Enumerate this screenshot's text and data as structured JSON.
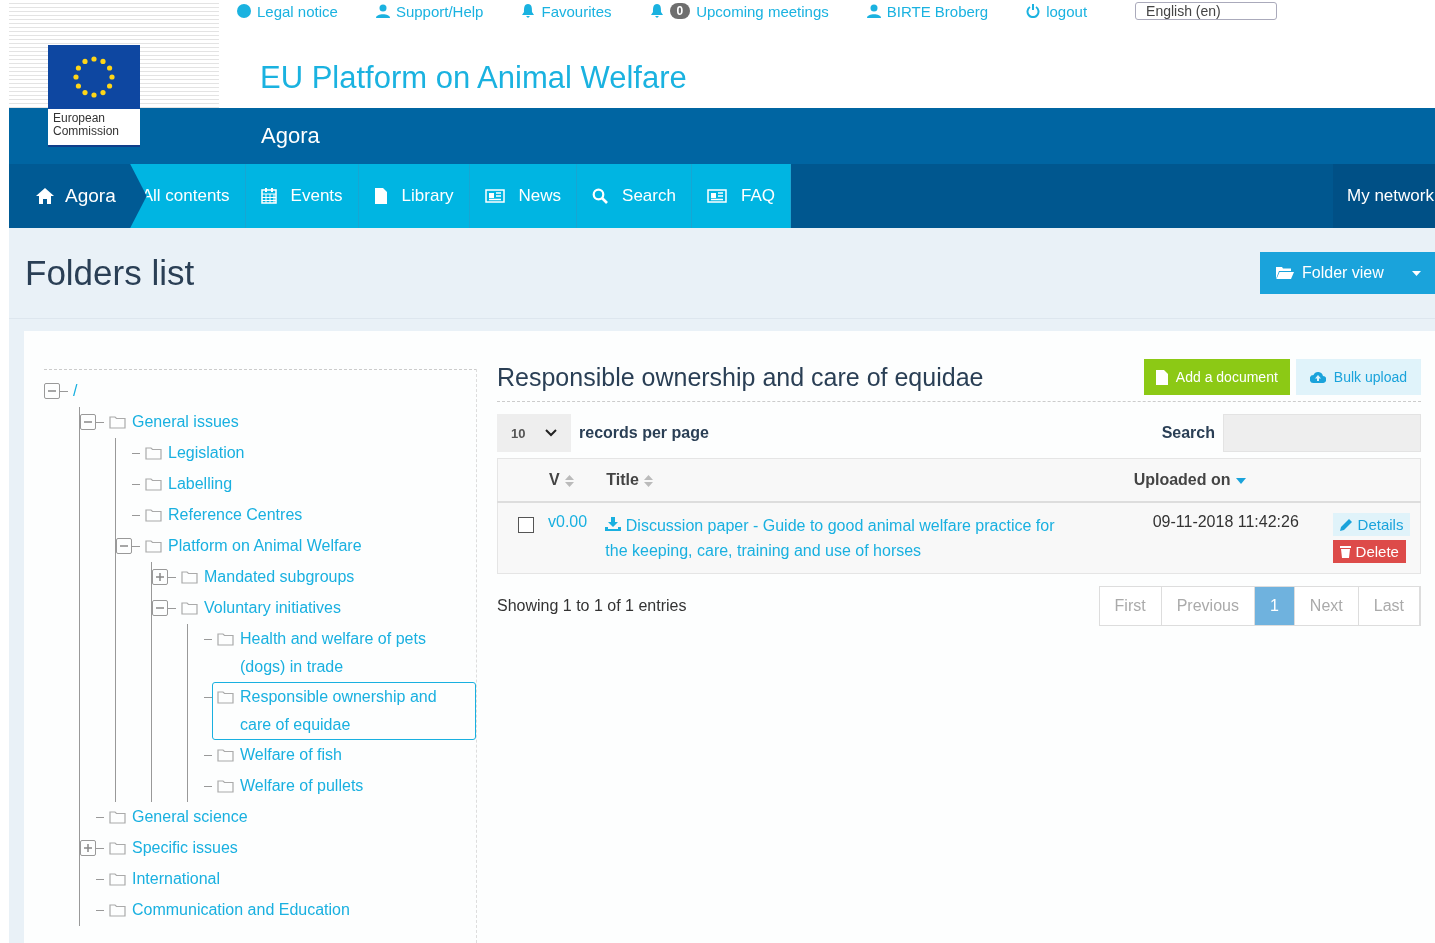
{
  "top_links": [
    {
      "label": "Legal notice"
    },
    {
      "label": "Support/Help"
    },
    {
      "label": "Favourites"
    },
    {
      "label": "Upcoming meetings",
      "badge": "0"
    },
    {
      "label": "BIRTE Broberg"
    },
    {
      "label": "logout"
    }
  ],
  "language": "English (en)",
  "header": {
    "logo_text": "European Commission",
    "site_title": "EU Platform on Animal Welfare",
    "subtitle": "Agora"
  },
  "nav": {
    "items": [
      {
        "label": "Agora",
        "selected": true
      },
      {
        "label": "All contents",
        "selected": false
      },
      {
        "label": "Events",
        "selected": false
      },
      {
        "label": "Library",
        "selected": false
      },
      {
        "label": "News",
        "selected": false
      },
      {
        "label": "Search",
        "selected": false
      },
      {
        "label": "FAQ",
        "selected": false
      }
    ],
    "right": "My network"
  },
  "page_title": "Folders list",
  "folder_view_button": "Folder view",
  "tree": {
    "label": "/",
    "expanded": true,
    "selected": false,
    "children": [
      {
        "label": "General issues",
        "expanded": true,
        "selected": false,
        "children": [
          {
            "label": "Legislation",
            "selected": false
          },
          {
            "label": "Labelling",
            "selected": false
          },
          {
            "label": "Reference Centres",
            "selected": false
          },
          {
            "label": "Platform on Animal Welfare",
            "expanded": true,
            "selected": false,
            "children": [
              {
                "label": "Mandated subgroups",
                "expanded": false,
                "selected": false
              },
              {
                "label": "Voluntary initiatives",
                "expanded": true,
                "selected": false,
                "children": [
                  {
                    "label": "Health and welfare of pets (dogs) in trade",
                    "selected": false
                  },
                  {
                    "label": "Responsible ownership and care of equidae",
                    "selected": true
                  },
                  {
                    "label": "Welfare of fish",
                    "selected": false
                  },
                  {
                    "label": "Welfare of pullets",
                    "selected": false
                  }
                ]
              }
            ]
          }
        ]
      },
      {
        "label": "General science",
        "selected": false
      },
      {
        "label": "Specific issues",
        "expanded": false,
        "selected": false
      },
      {
        "label": "International",
        "selected": false
      },
      {
        "label": "Communication and Education",
        "selected": false
      }
    ]
  },
  "folder": {
    "title": "Responsible ownership and care of equidae",
    "add_button": "Add a document",
    "bulk_button": "Bulk upload"
  },
  "table": {
    "page_size": "10",
    "page_size_label": "records per page",
    "search_label": "Search",
    "columns": [
      {
        "label": "V"
      },
      {
        "label": "Title"
      },
      {
        "label": "Uploaded on"
      }
    ],
    "rows": [
      {
        "checked": false,
        "version": "v0.00",
        "title": "Discussion paper - Guide to good animal welfare practice for the keeping, care, training and use of horses",
        "uploaded": "09-11-2018 11:42:26",
        "details": "Details",
        "delete": "Delete"
      }
    ]
  },
  "footer": {
    "info": "Showing 1 to 1 of 1 entries",
    "pages": [
      {
        "label": "First",
        "selected": false,
        "disabled": true
      },
      {
        "label": "Previous",
        "selected": false,
        "disabled": true
      },
      {
        "label": "1",
        "selected": true,
        "disabled": false
      },
      {
        "label": "Next",
        "selected": false,
        "disabled": true
      },
      {
        "label": "Last",
        "selected": false,
        "disabled": true
      }
    ]
  }
}
